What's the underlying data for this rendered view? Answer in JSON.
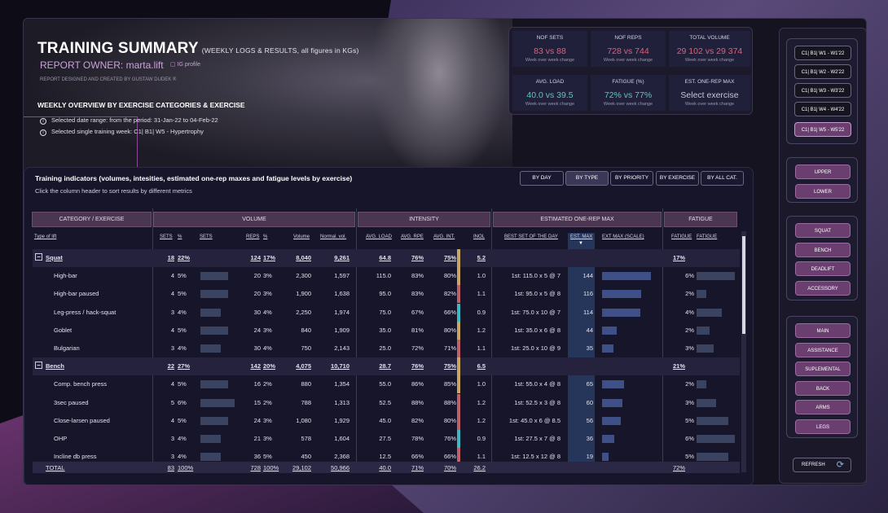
{
  "header": {
    "title": "TRAINING SUMMARY",
    "title_note": "(WEEKLY LOGS & RESULTS, all figures in KGs)",
    "owner": "REPORT OWNER: marta.lift",
    "ig": "IG profile",
    "designed": "REPORT DESIGNED AND CREATED BY GUSTAW DUDEK ®",
    "weekly": "WEEKLY OVERVIEW BY EXERCISE CATEGORIES & EXERCISE",
    "info1": "Selected date range: from the period: 31-Jan-22 to 04-Feb-22",
    "info2": "Selected single training week: C1| B1| W5 - Hypertrophy"
  },
  "kpis": [
    {
      "title": "NOF SETS",
      "value": "83 vs 88",
      "sub": "Week over week change",
      "color": "red"
    },
    {
      "title": "NOF REPS",
      "value": "728 vs 744",
      "sub": "Week over week change",
      "color": "red"
    },
    {
      "title": "TOTAL VOLUME",
      "value": "29 102 vs 29 374",
      "sub": "Week over week change",
      "color": "red"
    },
    {
      "title": "AVG. LOAD",
      "value": "40.0 vs 39.5",
      "sub": "Week over week change",
      "color": "teal"
    },
    {
      "title": "FATIGUE (%)",
      "value": "72% vs 77%",
      "sub": "Week over week change",
      "color": "teal"
    },
    {
      "title": "EST. ONE-REP MAX",
      "value": "Select exercise",
      "sub": "Week over week change",
      "color": "grey"
    }
  ],
  "panel": {
    "title": "Training indicators (volumes, intesities, estimated one-rep maxes and fatigue levels by exercise)",
    "subtitle": "Click the column header to sort results by different metrics",
    "tabs": [
      "BY DAY",
      "BY TYPE",
      "BY PRIORITY",
      "BY EXERCISE",
      "BY ALL CAT."
    ],
    "groups": [
      "CATEGORY / EXERCISE",
      "VOLUME",
      "INTENSITY",
      "ESTIMATED ONE-REP MAX",
      "FATIGUE"
    ],
    "cols": [
      "Type of lift",
      "SETS",
      "%",
      "SETS",
      "REPS",
      "%",
      "Volume",
      "Normal. vol.",
      "AVG. LOAD",
      "AVG. RPE",
      "AVG. INT.",
      "INOL",
      "BEST SET OF THE DAY",
      "EST. MAX",
      "EXT MAX (SCALE)",
      "FATIGUE",
      "FATIGUE"
    ],
    "sort_arrow": "▼"
  },
  "rows": [
    {
      "type": "cat",
      "expander": "−",
      "name": "Squat",
      "sets": "18",
      "sp": "22%",
      "setbar": 0,
      "reps": "124",
      "rp": "17%",
      "vol": "8,040",
      "nvol": "9,261",
      "load": "64.8",
      "rpe": "76%",
      "int": "75%",
      "inol": "5.2",
      "best": "",
      "est": "",
      "estbar": 0,
      "fat": "17%",
      "fatbar": 0,
      "strip": "#c8a860"
    },
    {
      "type": "ex",
      "name": "High-bar",
      "sets": "4",
      "sp": "5%",
      "setbar": 0.8,
      "reps": "20",
      "rp": "3%",
      "vol": "2,300",
      "nvol": "1,597",
      "load": "115.0",
      "rpe": "83%",
      "int": "80%",
      "inol": "1.0",
      "best": "1st: 115.0 x 5 @ 7",
      "est": "144",
      "estbar": 1.0,
      "fat": "6%",
      "fatbar": 1.0,
      "strip": "#c8a860"
    },
    {
      "type": "ex",
      "name": "High-bar paused",
      "sets": "4",
      "sp": "5%",
      "setbar": 0.8,
      "reps": "20",
      "rp": "3%",
      "vol": "1,900",
      "nvol": "1,638",
      "load": "95.0",
      "rpe": "83%",
      "int": "82%",
      "inol": "1.1",
      "best": "1st: 95.0 x 5 @ 8",
      "est": "116",
      "estbar": 0.8,
      "fat": "2%",
      "fatbar": 0.25,
      "strip": "#c06068"
    },
    {
      "type": "ex",
      "name": "Leg-press / hack-squat",
      "sets": "3",
      "sp": "4%",
      "setbar": 0.6,
      "reps": "30",
      "rp": "4%",
      "vol": "2,250",
      "nvol": "1,974",
      "load": "75.0",
      "rpe": "67%",
      "int": "66%",
      "inol": "0.9",
      "best": "1st: 75.0 x 10 @ 7",
      "est": "114",
      "estbar": 0.78,
      "fat": "4%",
      "fatbar": 0.65,
      "strip": "#40b8c0"
    },
    {
      "type": "ex",
      "name": "Goblet",
      "sets": "4",
      "sp": "5%",
      "setbar": 0.8,
      "reps": "24",
      "rp": "3%",
      "vol": "840",
      "nvol": "1,909",
      "load": "35.0",
      "rpe": "81%",
      "int": "80%",
      "inol": "1.2",
      "best": "1st: 35.0 x 6 @ 8",
      "est": "44",
      "estbar": 0.3,
      "fat": "2%",
      "fatbar": 0.35,
      "strip": "#c8a860"
    },
    {
      "type": "ex",
      "name": "Bulgarian",
      "sets": "3",
      "sp": "4%",
      "setbar": 0.6,
      "reps": "30",
      "rp": "4%",
      "vol": "750",
      "nvol": "2,143",
      "load": "25.0",
      "rpe": "72%",
      "int": "71%",
      "inol": "1.1",
      "best": "1st: 25.0 x 10 @ 9",
      "est": "35",
      "estbar": 0.24,
      "fat": "3%",
      "fatbar": 0.45,
      "strip": "#c06068"
    },
    {
      "type": "cat",
      "expander": "−",
      "name": "Bench",
      "sets": "22",
      "sp": "27%",
      "setbar": 0,
      "reps": "142",
      "rp": "20%",
      "vol": "4,075",
      "nvol": "10,710",
      "load": "28.7",
      "rpe": "76%",
      "int": "75%",
      "inol": "6.5",
      "best": "",
      "est": "",
      "estbar": 0,
      "fat": "21%",
      "fatbar": 0,
      "strip": "#c8a860"
    },
    {
      "type": "ex",
      "name": "Comp. bench press",
      "sets": "4",
      "sp": "5%",
      "setbar": 0.8,
      "reps": "16",
      "rp": "2%",
      "vol": "880",
      "nvol": "1,354",
      "load": "55.0",
      "rpe": "86%",
      "int": "85%",
      "inol": "1.0",
      "best": "1st: 55.0 x 4 @ 8",
      "est": "65",
      "estbar": 0.45,
      "fat": "2%",
      "fatbar": 0.25,
      "strip": "#c8a860"
    },
    {
      "type": "ex",
      "name": "3sec paused",
      "sets": "5",
      "sp": "6%",
      "setbar": 1.0,
      "reps": "15",
      "rp": "2%",
      "vol": "788",
      "nvol": "1,313",
      "load": "52.5",
      "rpe": "88%",
      "int": "88%",
      "inol": "1.2",
      "best": "1st: 52.5 x 3 @ 8",
      "est": "60",
      "estbar": 0.42,
      "fat": "3%",
      "fatbar": 0.5,
      "strip": "#c06068"
    },
    {
      "type": "ex",
      "name": "Close-larsen paused",
      "sets": "4",
      "sp": "5%",
      "setbar": 0.8,
      "reps": "24",
      "rp": "3%",
      "vol": "1,080",
      "nvol": "1,929",
      "load": "45.0",
      "rpe": "82%",
      "int": "80%",
      "inol": "1.2",
      "best": "1st: 45.0 x 6 @ 8.5",
      "est": "56",
      "estbar": 0.39,
      "fat": "5%",
      "fatbar": 0.82,
      "strip": "#c06068"
    },
    {
      "type": "ex",
      "name": "OHP",
      "sets": "3",
      "sp": "4%",
      "setbar": 0.6,
      "reps": "21",
      "rp": "3%",
      "vol": "578",
      "nvol": "1,604",
      "load": "27.5",
      "rpe": "78%",
      "int": "76%",
      "inol": "0.9",
      "best": "1st: 27.5 x 7 @ 8",
      "est": "36",
      "estbar": 0.25,
      "fat": "6%",
      "fatbar": 1.0,
      "strip": "#40b8c0"
    },
    {
      "type": "ex",
      "name": "Incline db press",
      "sets": "3",
      "sp": "4%",
      "setbar": 0.6,
      "reps": "36",
      "rp": "5%",
      "vol": "450",
      "nvol": "2,368",
      "load": "12.5",
      "rpe": "66%",
      "int": "66%",
      "inol": "1.1",
      "best": "1st: 12.5 x 12 @ 8",
      "est": "19",
      "estbar": 0.14,
      "fat": "5%",
      "fatbar": 0.82,
      "strip": "#c06068"
    }
  ],
  "total": {
    "name": "TOTAL",
    "sets": "83",
    "sp": "100%",
    "reps": "728",
    "rp": "100%",
    "vol": "29,102",
    "nvol": "50,966",
    "load": "40.0",
    "rpe": "71%",
    "int": "70%",
    "inol": "26.2",
    "fat": "72%"
  },
  "sidebar": {
    "weeks": [
      "C1| B1| W1 - W1'22",
      "C1| B1| W2 - W2'22",
      "C1| B1| W3 - W3'22",
      "C1| B1| W4 - W4'22",
      "C1| B1| W5 - W5'22"
    ],
    "body": [
      "UPPER",
      "LOWER"
    ],
    "cats": [
      "SQUAT",
      "BENCH",
      "DEADLIFT",
      "ACCESSORY"
    ],
    "prio": [
      "MAIN",
      "ASSISTANCE",
      "SUPLEMENTAL",
      "BACK",
      "ARMS",
      "LEGS"
    ],
    "refresh": "REFRESH",
    "refresh_icon": "⟳"
  }
}
